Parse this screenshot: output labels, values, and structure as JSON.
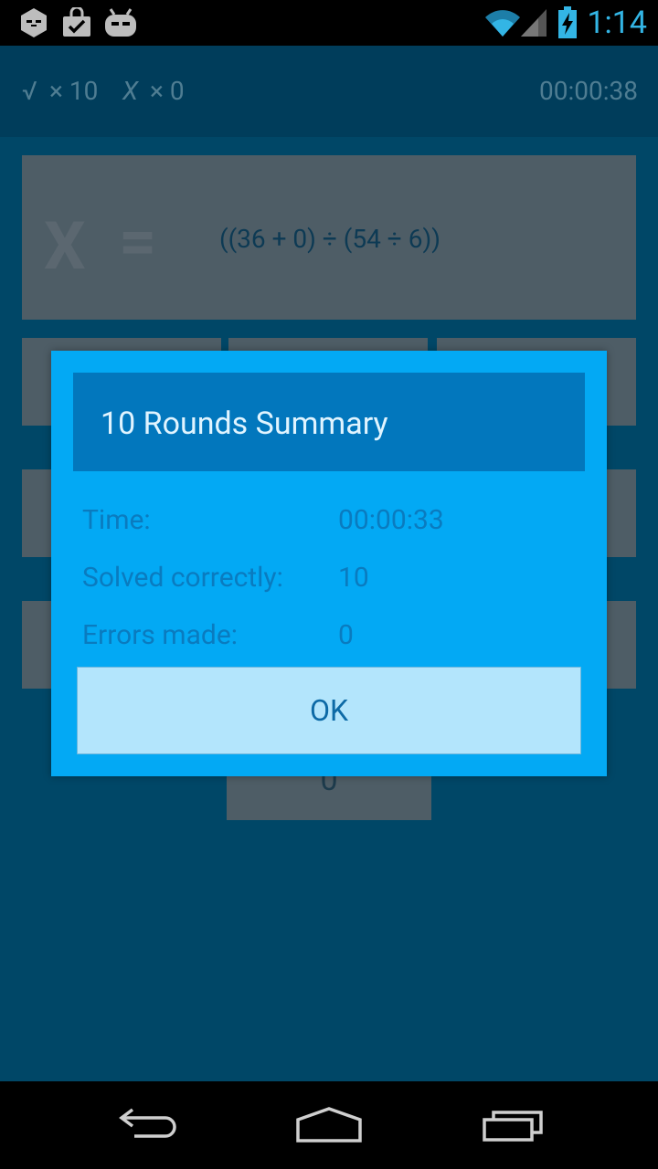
{
  "status_bar": {
    "time": "1:14",
    "icons": [
      "notification-hex-icon",
      "shopping-bag-check-icon",
      "cyanogenmod-android-icon",
      "wifi-icon",
      "signal-icon",
      "battery-charging-icon"
    ]
  },
  "scorebar": {
    "correct_symbol": "√",
    "correct_count": "× 10",
    "wrong_symbol": "X",
    "wrong_count": "× 0",
    "timer": "00:00:38"
  },
  "equation": {
    "variable": "X",
    "equals": "=",
    "expression": "((36 + 0) ÷ (54 ÷ 6))"
  },
  "keypad": {
    "bottom_key": "0"
  },
  "dialog": {
    "title": "10 Rounds Summary",
    "rows": [
      {
        "label": "Time:",
        "value": "00:00:33"
      },
      {
        "label": "Solved correctly:",
        "value": "10"
      },
      {
        "label": "Errors made:",
        "value": "0"
      }
    ],
    "ok_label": "OK"
  },
  "nav": {
    "icons": [
      "back-icon",
      "home-icon",
      "recent-apps-icon"
    ]
  },
  "colors": {
    "background": "#004767",
    "dialog": "#03a9f4",
    "dialog_header": "#0277bd",
    "ok_button": "#b3e5fc",
    "status_accent": "#33b5e5"
  }
}
